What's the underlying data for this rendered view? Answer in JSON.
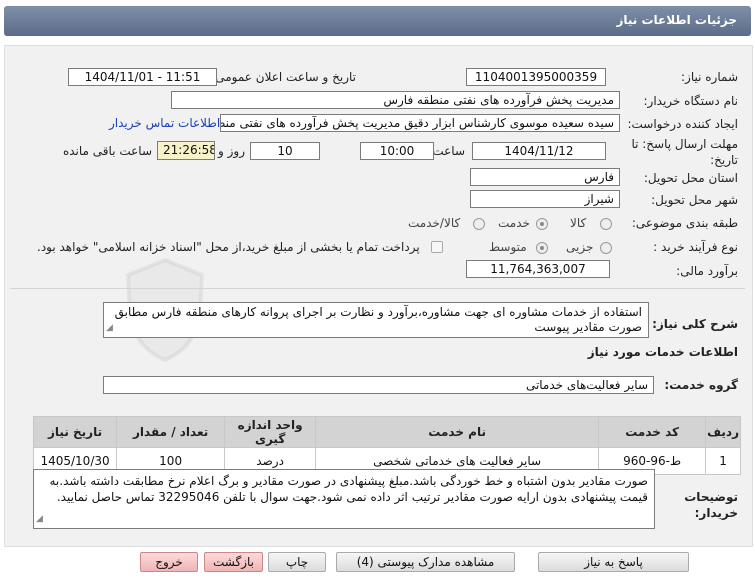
{
  "header": {
    "title": "جزئیات اطلاعات نیاز"
  },
  "form": {
    "need_number_label": "شماره نیاز:",
    "need_number": "1104001395000359",
    "announce_label": "تاریخ و ساعت اعلان عمومی:",
    "announce_value": "1404/11/01 - 11:51",
    "buyer_org_label": "نام دستگاه خریدار:",
    "buyer_org": "مدیریت پخش فرآورده های نفتی منطقه فارس",
    "creator_label": "ایجاد کننده درخواست:",
    "creator": "سیده سعیده موسوی کارشناس ابزار دقیق مدیریت پخش فرآورده های نفتی منط",
    "contact_link": "اطلاعات تماس خریدار",
    "deadline_label_1": "مهلت ارسال پاسخ: تا",
    "deadline_label_2": "تاریخ:",
    "deadline_date": "1404/11/12",
    "time_label": "ساعت",
    "deadline_time": "10:00",
    "days_value": "10",
    "days_label": "روز و",
    "remaining_value": "21:26:58",
    "remaining_label": "ساعت باقی مانده",
    "province_label": "استان محل تحویل:",
    "province": "فارس",
    "city_label": "شهر محل تحویل:",
    "city": "شیراز",
    "category_label": "طبقه بندی موضوعی:",
    "category_options": [
      "کالا",
      "خدمت",
      "کالا/خدمت"
    ],
    "category_selected": "خدمت",
    "process_label": "نوع فرآیند خرید :",
    "process_options": [
      "جزیی",
      "متوسط"
    ],
    "process_selected": "متوسط",
    "payment_note": "پرداخت تمام یا بخشی از مبلغ خرید،از محل \"اسناد خزانه اسلامی\" خواهد بود.",
    "estimate_label": "برآورد مالی:",
    "estimate": "11,764,363,007"
  },
  "summary": {
    "label": "شرح کلی نیاز:",
    "text": "استفاده از خدمات مشاوره ای جهت مشاوره،برآورد و نظارت بر اجرای پروانه کارهای منطقه فارس مطابق صورت مقادیر پیوست"
  },
  "services": {
    "section_title": "اطلاعات خدمات مورد نیاز",
    "group_label": "گروه خدمت:",
    "group_value": "سایر فعالیت‌های خدماتی",
    "columns": [
      "ردیف",
      "کد خدمت",
      "نام خدمت",
      "واحد اندازه گیری",
      "تعداد / مقدار",
      "تاریخ نیاز"
    ],
    "rows": [
      {
        "row": "1",
        "code": "ط-96-960",
        "name": "سایر فعالیت های خدماتی شخصی",
        "unit": "درصد",
        "qty": "100",
        "date": "1405/10/30"
      }
    ]
  },
  "buyer_notes": {
    "label_1": "توضیحات",
    "label_2": "خریدار:",
    "text": "صورت مقادیر بدون اشتباه و خط خوردگی باشد.مبلغ پیشنهادی در صورت مقادیر و برگ اعلام نرخ مطابقت داشته باشد.به قیمت پیشنهادی بدون ارایه صورت مقادیر ترتیب اثر داده نمی شود.جهت سوال با تلفن 32295046 تماس حاصل نمایید."
  },
  "buttons": {
    "reply": "پاسخ به نیاز",
    "attachments": "مشاهده مدارک پیوستی (4)",
    "print": "چاپ",
    "back": "بازگشت",
    "exit": "خروج"
  },
  "colors": {
    "header_bg": "#6b7c97",
    "link": "#1a3fb8",
    "remaining_bg": "#f6f3c8",
    "exit_bg": "#f0b5b5"
  },
  "icons": {
    "watermark": "shield-logo-icon"
  }
}
